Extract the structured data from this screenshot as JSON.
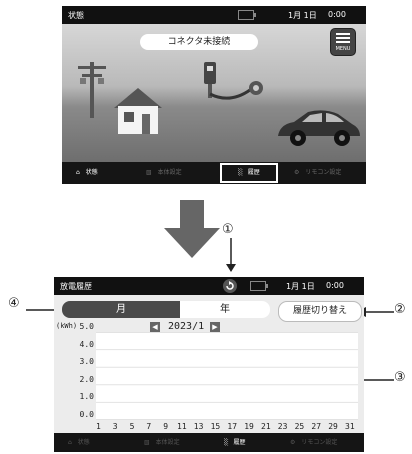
{
  "top_screen": {
    "status_title": "状態",
    "status_date": "1月 1日",
    "status_time": "0:00",
    "connector_status": "コネクタ未接続",
    "menu_label": "MENU",
    "tabs": [
      {
        "label": "状態",
        "state": "active"
      },
      {
        "label": "本体設定",
        "state": "dim"
      },
      {
        "label": "履歴",
        "state": "selected"
      },
      {
        "label": "リモコン設定",
        "state": "dim"
      }
    ]
  },
  "bottom_screen": {
    "status_title": "放電履歴",
    "status_date": "1月 1日",
    "status_time": "0:00",
    "period_tabs": {
      "month": "月",
      "year": "年"
    },
    "switch_button": "履歴切り替え",
    "unit_label": "(kWh)",
    "current_period": "2023/1",
    "tabs": [
      {
        "label": "状態",
        "state": "dim"
      },
      {
        "label": "本体設定",
        "state": "dim"
      },
      {
        "label": "履歴",
        "state": "active"
      },
      {
        "label": "リモコン設定",
        "state": "dim"
      }
    ]
  },
  "callouts": {
    "c1": "①",
    "c2": "②",
    "c3": "③",
    "c4": "④"
  },
  "icons": [
    "home-icon",
    "settings-icon",
    "history-icon",
    "gear-icon",
    "refresh-icon",
    "battery-icon",
    "menu-icon",
    "prev-arrow-icon",
    "next-arrow-icon"
  ],
  "chart_data": {
    "type": "bar",
    "ylabel": "(kWh)",
    "ylim": [
      0,
      5
    ],
    "yticks": [
      "5.0",
      "4.0",
      "3.0",
      "2.0",
      "1.0",
      "0.0"
    ],
    "x_tick_labels": [
      "1",
      "3",
      "5",
      "7",
      "9",
      "11",
      "13",
      "15",
      "17",
      "19",
      "21",
      "23",
      "25",
      "27",
      "29",
      "31"
    ],
    "values": []
  }
}
